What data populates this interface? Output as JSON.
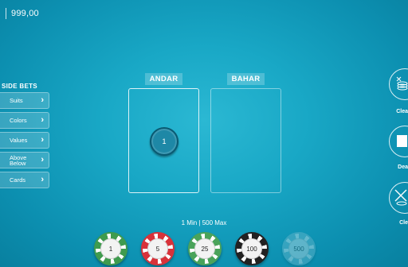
{
  "balance": "999,00",
  "side_bets": {
    "title": "SIDE BETS",
    "items": [
      {
        "label": "Suits"
      },
      {
        "label": "Colors"
      },
      {
        "label": "Values"
      },
      {
        "label_line1": "Above",
        "label_line2": "Below"
      },
      {
        "label": "Cards"
      }
    ]
  },
  "bet_areas": {
    "andar": {
      "label": "ANDAR",
      "chip_value": "1"
    },
    "bahar": {
      "label": "BAHAR"
    }
  },
  "right_controls": [
    {
      "label": "Clea",
      "icon": "clear-chips-icon"
    },
    {
      "label": "Dea",
      "icon": "deal-icon"
    },
    {
      "label": "Cle",
      "icon": "clear-icon"
    }
  ],
  "limits": "1 Min | 500 Max",
  "chips": [
    {
      "value": "1",
      "color": "#3f9b4e"
    },
    {
      "value": "5",
      "color": "#d8323a"
    },
    {
      "value": "25",
      "color": "#4aa35a"
    },
    {
      "value": "100",
      "color": "#222222"
    },
    {
      "value": "500",
      "color": "#7fc0d2"
    }
  ]
}
